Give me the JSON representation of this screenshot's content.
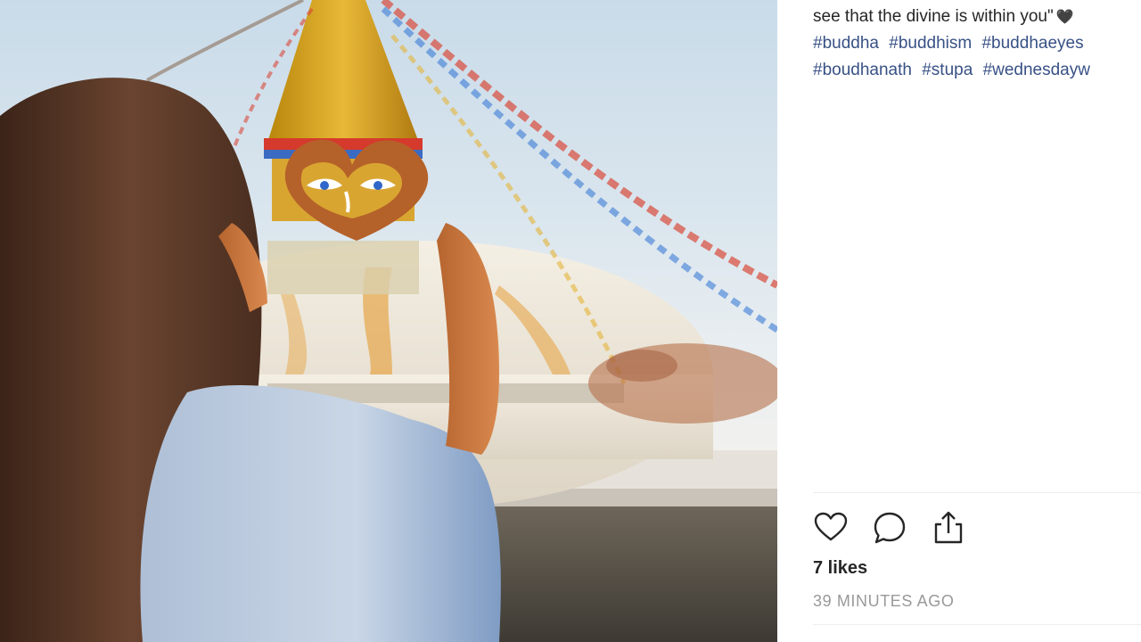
{
  "post": {
    "caption_line": "see that the divine is within you\"",
    "caption_emoji": "heart-emoji",
    "hashtags_row1": [
      "#buddha",
      "#buddhism",
      "#buddhaeyes"
    ],
    "hashtags_row2": [
      "#boudhanath",
      "#stupa",
      "#wednesdayw"
    ],
    "likes": "7 likes",
    "time": "39 MINUTES AGO"
  },
  "actions": {
    "like_icon": "heart-outline-icon",
    "comment_icon": "speech-bubble-icon",
    "share_icon": "share-upload-icon"
  },
  "colors": {
    "hashtag": "#385185",
    "text": "#262626",
    "muted": "#999999",
    "divider": "#efefef"
  }
}
